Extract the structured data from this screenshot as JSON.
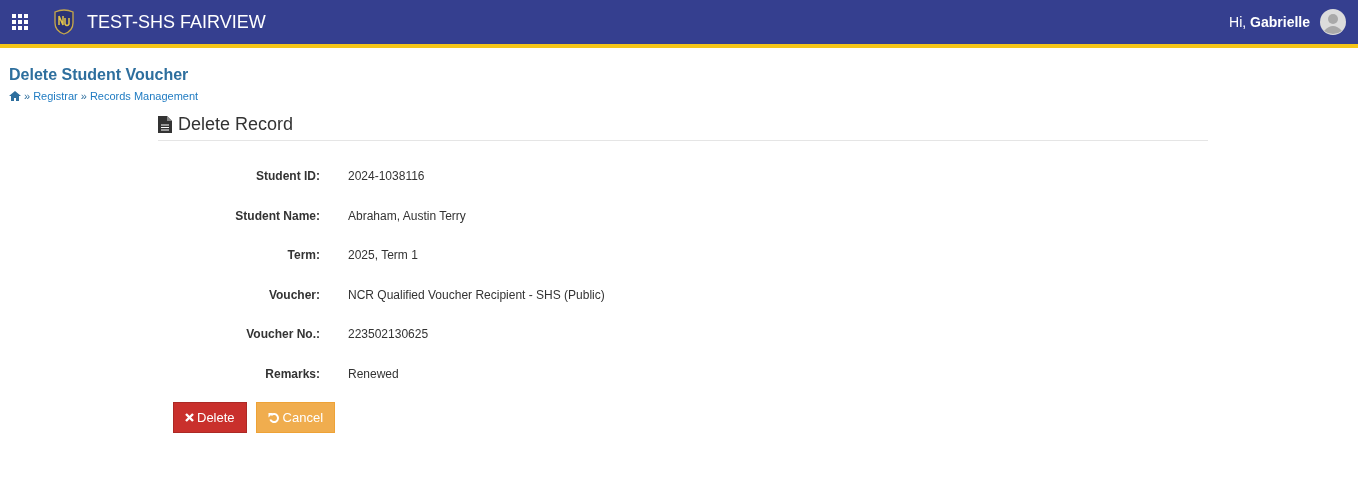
{
  "header": {
    "title": "TEST-SHS FAIRVIEW",
    "greeting": "Hi, ",
    "user": "Gabrielle"
  },
  "page": {
    "title": "Delete Student Voucher",
    "breadcrumbs": [
      {
        "separator": "»",
        "label": "Registrar"
      },
      {
        "separator": "»",
        "label": "Records Management"
      }
    ]
  },
  "panel": {
    "title": "Delete Record",
    "fields": [
      {
        "label": "Student ID:",
        "value": "2024-1038116"
      },
      {
        "label": "Student Name:",
        "value": "Abraham, Austin Terry"
      },
      {
        "label": "Term:",
        "value": "2025, Term 1"
      },
      {
        "label": "Voucher:",
        "value": "NCR Qualified Voucher Recipient - SHS (Public)"
      },
      {
        "label": "Voucher No.:",
        "value": "223502130625"
      },
      {
        "label": "Remarks:",
        "value": "Renewed"
      }
    ],
    "buttons": [
      {
        "label": "Delete",
        "kind": "danger"
      },
      {
        "label": "Cancel",
        "kind": "cancel"
      }
    ]
  }
}
